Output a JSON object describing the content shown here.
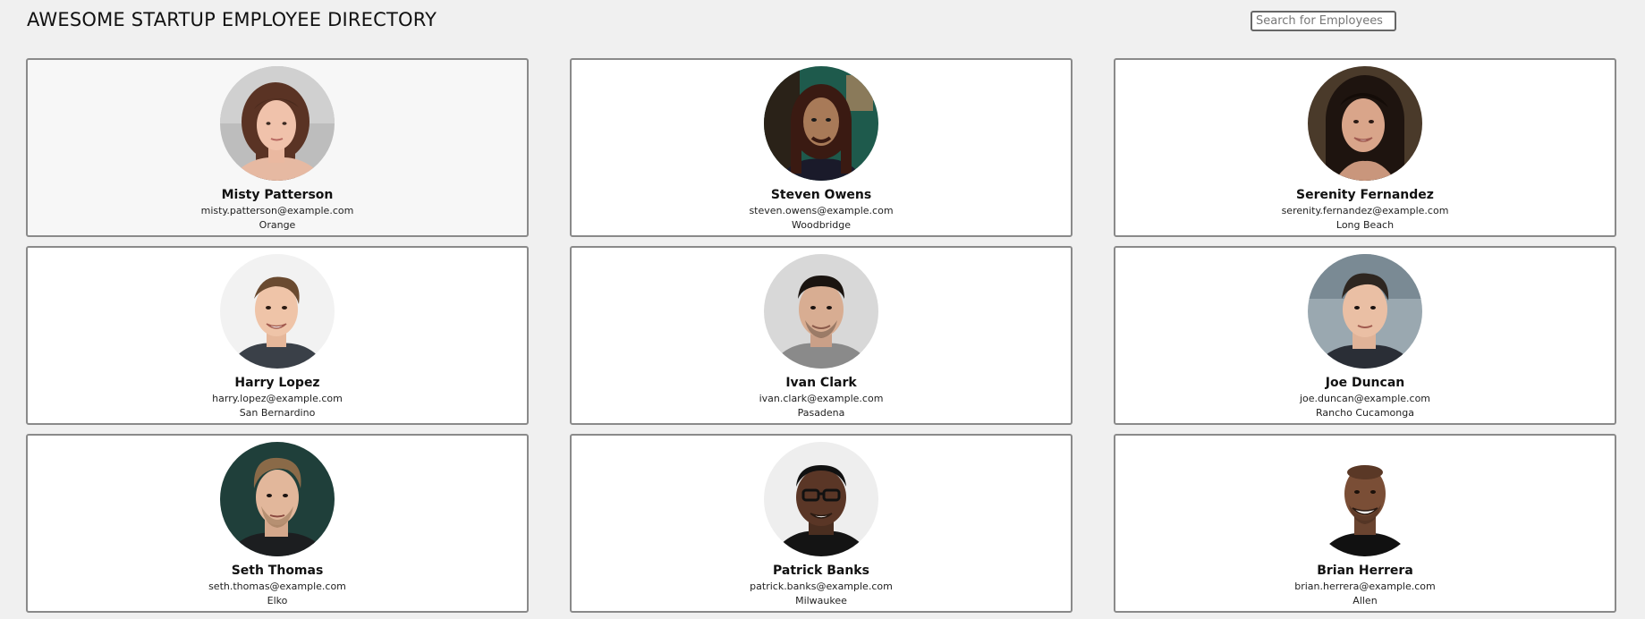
{
  "header": {
    "title": "AWESOME STARTUP EMPLOYEE DIRECTORY",
    "search_placeholder": "Search for Employees"
  },
  "employees": [
    {
      "name": "Misty Patterson",
      "email": "misty.patterson@example.com",
      "city": "Orange"
    },
    {
      "name": "Steven Owens",
      "email": "steven.owens@example.com",
      "city": "Woodbridge"
    },
    {
      "name": "Serenity Fernandez",
      "email": "serenity.fernandez@example.com",
      "city": "Long Beach"
    },
    {
      "name": "Harry Lopez",
      "email": "harry.lopez@example.com",
      "city": "San Bernardino"
    },
    {
      "name": "Ivan Clark",
      "email": "ivan.clark@example.com",
      "city": "Pasadena"
    },
    {
      "name": "Joe Duncan",
      "email": "joe.duncan@example.com",
      "city": "Rancho Cucamonga"
    },
    {
      "name": "Seth Thomas",
      "email": "seth.thomas@example.com",
      "city": "Elko"
    },
    {
      "name": "Patrick Banks",
      "email": "patrick.banks@example.com",
      "city": "Milwaukee"
    },
    {
      "name": "Brian Herrera",
      "email": "brian.herrera@example.com",
      "city": "Allen"
    }
  ]
}
